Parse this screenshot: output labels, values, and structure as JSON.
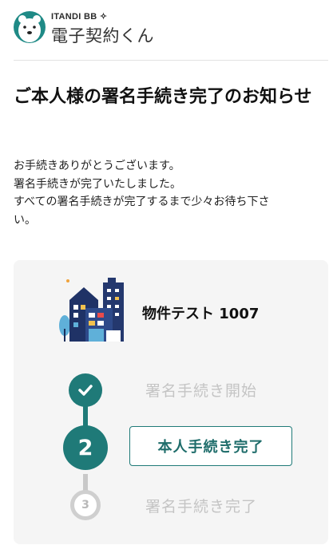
{
  "brand": {
    "top_label": "ITANDI BB",
    "name": "電子契約くん",
    "logo_icon": "polar-bear-icon"
  },
  "title": "ご本人様の署名手続き完了のお知らせ",
  "message": {
    "lines": [
      "お手続きありがとうございます。",
      "署名手続きが完了いたしました。",
      "すべての署名手続きが完了するまで少々お待ち下さ",
      "い。"
    ]
  },
  "property": {
    "name": "物件テスト 1007",
    "icon": "building-icon"
  },
  "steps": [
    {
      "label": "署名手続き開始",
      "status": "done",
      "icon": "check-icon"
    },
    {
      "number": "2",
      "label": "本人手続き完了",
      "status": "current"
    },
    {
      "number": "3",
      "label": "署名手続き完了",
      "status": "pending"
    }
  ],
  "colors": {
    "accent": "#1f7a78",
    "inactive_text": "#c4c4c4",
    "card_bg": "#f5f5f5"
  }
}
